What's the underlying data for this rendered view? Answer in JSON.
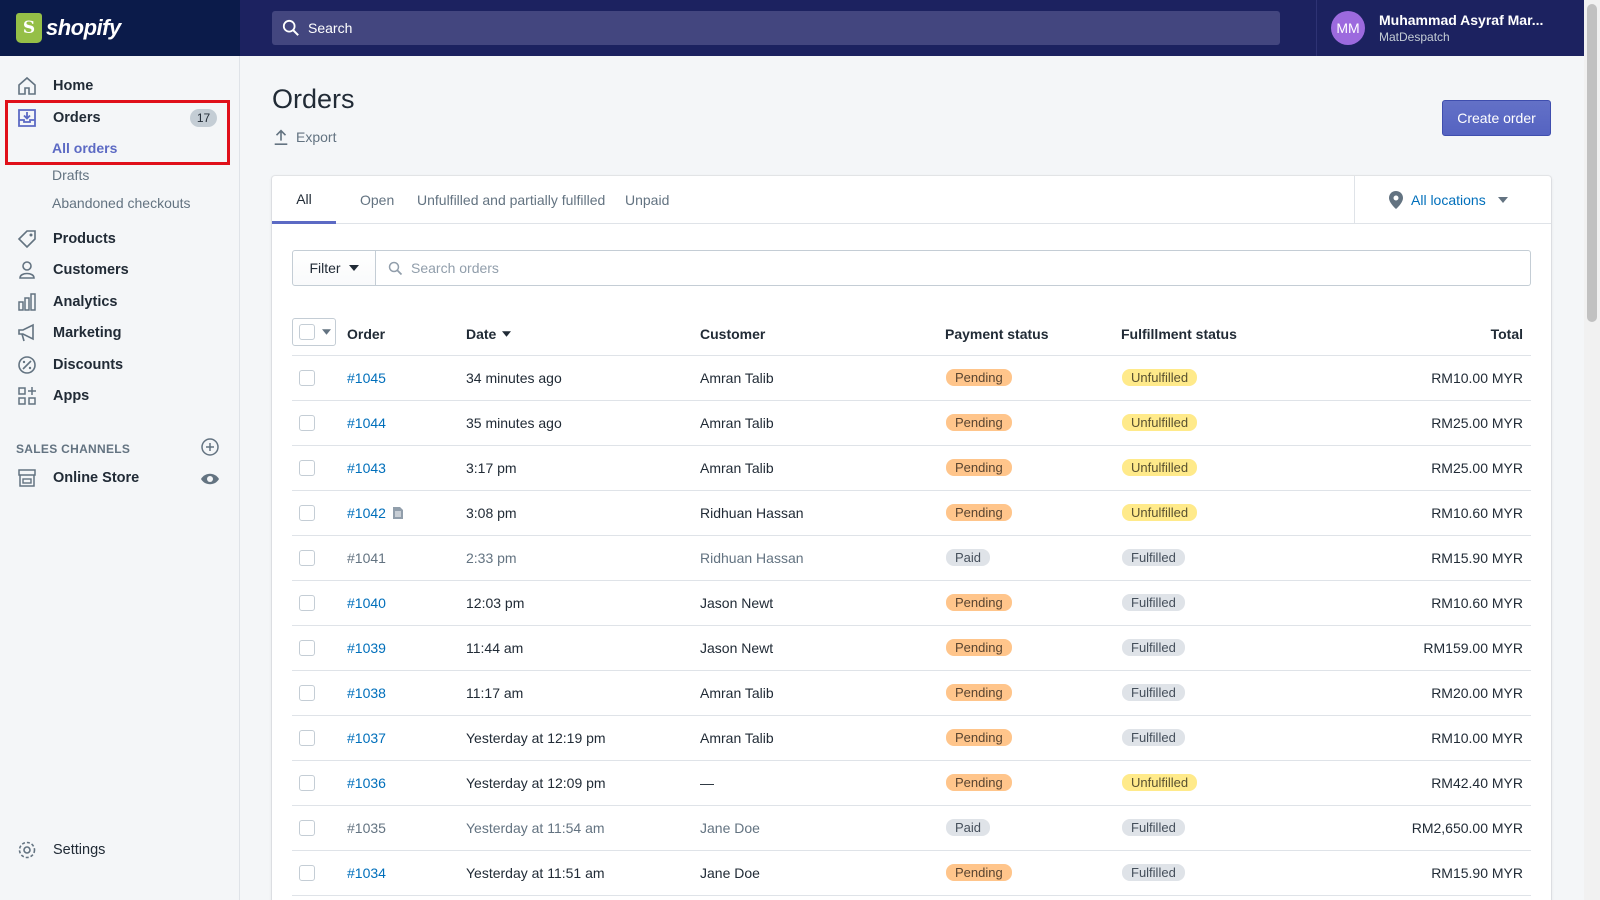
{
  "app": {
    "brand": "shopify",
    "brand_color": "#95bf47",
    "accent_color": "#5c6ac4"
  },
  "topbar": {
    "search_placeholder": "Search",
    "user": {
      "initials": "MM",
      "name": "Muhammad Asyraf Mar...",
      "store": "MatDespatch"
    }
  },
  "sidebar": {
    "home": "Home",
    "orders": "Orders",
    "orders_count": "17",
    "all_orders": "All orders",
    "drafts": "Drafts",
    "abandoned": "Abandoned checkouts",
    "products": "Products",
    "customers": "Customers",
    "analytics": "Analytics",
    "marketing": "Marketing",
    "discounts": "Discounts",
    "apps": "Apps",
    "sales_channels": "SALES CHANNELS",
    "online_store": "Online Store",
    "settings": "Settings"
  },
  "page": {
    "title": "Orders",
    "export": "Export",
    "create_order": "Create order"
  },
  "tabs": [
    "All",
    "Open",
    "Unfulfilled and partially fulfilled",
    "Unpaid"
  ],
  "location": "All locations",
  "filter": {
    "label": "Filter",
    "search_placeholder": "Search orders"
  },
  "table": {
    "headers": {
      "order": "Order",
      "date": "Date",
      "customer": "Customer",
      "payment": "Payment status",
      "fulfillment": "Fulfillment status",
      "total": "Total"
    },
    "rows": [
      {
        "order": "#1045",
        "date": "34 minutes ago",
        "customer": "Amran Talib",
        "payment": "Pending",
        "fulfillment": "Unfulfilled",
        "total": "RM10.00 MYR"
      },
      {
        "order": "#1044",
        "date": "35 minutes ago",
        "customer": "Amran Talib",
        "payment": "Pending",
        "fulfillment": "Unfulfilled",
        "total": "RM25.00 MYR"
      },
      {
        "order": "#1043",
        "date": "3:17 pm",
        "customer": "Amran Talib",
        "payment": "Pending",
        "fulfillment": "Unfulfilled",
        "total": "RM25.00 MYR"
      },
      {
        "order": "#1042",
        "date": "3:08 pm",
        "customer": "Ridhuan Hassan",
        "payment": "Pending",
        "fulfillment": "Unfulfilled",
        "total": "RM10.60 MYR"
      },
      {
        "order": "#1041",
        "date": "2:33 pm",
        "customer": "Ridhuan Hassan",
        "payment": "Paid",
        "fulfillment": "Fulfilled",
        "total": "RM15.90 MYR"
      },
      {
        "order": "#1040",
        "date": "12:03 pm",
        "customer": "Jason Newt",
        "payment": "Pending",
        "fulfillment": "Fulfilled",
        "total": "RM10.60 MYR"
      },
      {
        "order": "#1039",
        "date": "11:44 am",
        "customer": "Jason Newt",
        "payment": "Pending",
        "fulfillment": "Fulfilled",
        "total": "RM159.00 MYR"
      },
      {
        "order": "#1038",
        "date": "11:17 am",
        "customer": "Amran Talib",
        "payment": "Pending",
        "fulfillment": "Fulfilled",
        "total": "RM20.00 MYR"
      },
      {
        "order": "#1037",
        "date": "Yesterday at 12:19 pm",
        "customer": "Amran Talib",
        "payment": "Pending",
        "fulfillment": "Fulfilled",
        "total": "RM10.00 MYR"
      },
      {
        "order": "#1036",
        "date": "Yesterday at 12:09 pm",
        "customer": "—",
        "payment": "Pending",
        "fulfillment": "Unfulfilled",
        "total": "RM42.40 MYR"
      },
      {
        "order": "#1035",
        "date": "Yesterday at 11:54 am",
        "customer": "Jane Doe",
        "payment": "Paid",
        "fulfillment": "Fulfilled",
        "total": "RM2,650.00 MYR"
      },
      {
        "order": "#1034",
        "date": "Yesterday at 11:51 am",
        "customer": "Jane Doe",
        "payment": "Pending",
        "fulfillment": "Fulfilled",
        "total": "RM15.90 MYR"
      }
    ]
  }
}
